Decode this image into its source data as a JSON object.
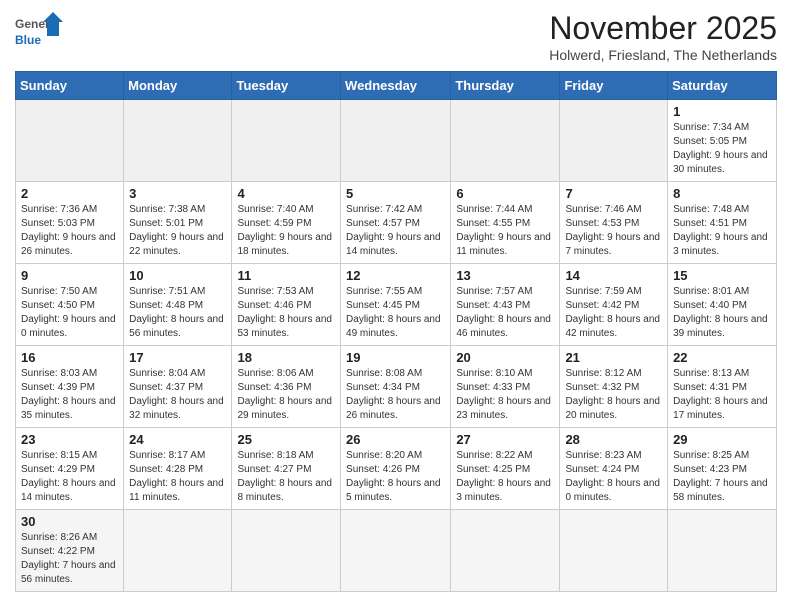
{
  "logo": {
    "general": "General",
    "blue": "Blue"
  },
  "title": "November 2025",
  "subtitle": "Holwerd, Friesland, The Netherlands",
  "headers": [
    "Sunday",
    "Monday",
    "Tuesday",
    "Wednesday",
    "Thursday",
    "Friday",
    "Saturday"
  ],
  "weeks": [
    [
      {
        "day": "",
        "info": "",
        "empty": true
      },
      {
        "day": "",
        "info": "",
        "empty": true
      },
      {
        "day": "",
        "info": "",
        "empty": true
      },
      {
        "day": "",
        "info": "",
        "empty": true
      },
      {
        "day": "",
        "info": "",
        "empty": true
      },
      {
        "day": "",
        "info": "",
        "empty": true
      },
      {
        "day": "1",
        "info": "Sunrise: 7:34 AM\nSunset: 5:05 PM\nDaylight: 9 hours and 30 minutes."
      }
    ],
    [
      {
        "day": "2",
        "info": "Sunrise: 7:36 AM\nSunset: 5:03 PM\nDaylight: 9 hours and 26 minutes."
      },
      {
        "day": "3",
        "info": "Sunrise: 7:38 AM\nSunset: 5:01 PM\nDaylight: 9 hours and 22 minutes."
      },
      {
        "day": "4",
        "info": "Sunrise: 7:40 AM\nSunset: 4:59 PM\nDaylight: 9 hours and 18 minutes."
      },
      {
        "day": "5",
        "info": "Sunrise: 7:42 AM\nSunset: 4:57 PM\nDaylight: 9 hours and 14 minutes."
      },
      {
        "day": "6",
        "info": "Sunrise: 7:44 AM\nSunset: 4:55 PM\nDaylight: 9 hours and 11 minutes."
      },
      {
        "day": "7",
        "info": "Sunrise: 7:46 AM\nSunset: 4:53 PM\nDaylight: 9 hours and 7 minutes."
      },
      {
        "day": "8",
        "info": "Sunrise: 7:48 AM\nSunset: 4:51 PM\nDaylight: 9 hours and 3 minutes."
      }
    ],
    [
      {
        "day": "9",
        "info": "Sunrise: 7:50 AM\nSunset: 4:50 PM\nDaylight: 9 hours and 0 minutes."
      },
      {
        "day": "10",
        "info": "Sunrise: 7:51 AM\nSunset: 4:48 PM\nDaylight: 8 hours and 56 minutes."
      },
      {
        "day": "11",
        "info": "Sunrise: 7:53 AM\nSunset: 4:46 PM\nDaylight: 8 hours and 53 minutes."
      },
      {
        "day": "12",
        "info": "Sunrise: 7:55 AM\nSunset: 4:45 PM\nDaylight: 8 hours and 49 minutes."
      },
      {
        "day": "13",
        "info": "Sunrise: 7:57 AM\nSunset: 4:43 PM\nDaylight: 8 hours and 46 minutes."
      },
      {
        "day": "14",
        "info": "Sunrise: 7:59 AM\nSunset: 4:42 PM\nDaylight: 8 hours and 42 minutes."
      },
      {
        "day": "15",
        "info": "Sunrise: 8:01 AM\nSunset: 4:40 PM\nDaylight: 8 hours and 39 minutes."
      }
    ],
    [
      {
        "day": "16",
        "info": "Sunrise: 8:03 AM\nSunset: 4:39 PM\nDaylight: 8 hours and 35 minutes."
      },
      {
        "day": "17",
        "info": "Sunrise: 8:04 AM\nSunset: 4:37 PM\nDaylight: 8 hours and 32 minutes."
      },
      {
        "day": "18",
        "info": "Sunrise: 8:06 AM\nSunset: 4:36 PM\nDaylight: 8 hours and 29 minutes."
      },
      {
        "day": "19",
        "info": "Sunrise: 8:08 AM\nSunset: 4:34 PM\nDaylight: 8 hours and 26 minutes."
      },
      {
        "day": "20",
        "info": "Sunrise: 8:10 AM\nSunset: 4:33 PM\nDaylight: 8 hours and 23 minutes."
      },
      {
        "day": "21",
        "info": "Sunrise: 8:12 AM\nSunset: 4:32 PM\nDaylight: 8 hours and 20 minutes."
      },
      {
        "day": "22",
        "info": "Sunrise: 8:13 AM\nSunset: 4:31 PM\nDaylight: 8 hours and 17 minutes."
      }
    ],
    [
      {
        "day": "23",
        "info": "Sunrise: 8:15 AM\nSunset: 4:29 PM\nDaylight: 8 hours and 14 minutes."
      },
      {
        "day": "24",
        "info": "Sunrise: 8:17 AM\nSunset: 4:28 PM\nDaylight: 8 hours and 11 minutes."
      },
      {
        "day": "25",
        "info": "Sunrise: 8:18 AM\nSunset: 4:27 PM\nDaylight: 8 hours and 8 minutes."
      },
      {
        "day": "26",
        "info": "Sunrise: 8:20 AM\nSunset: 4:26 PM\nDaylight: 8 hours and 5 minutes."
      },
      {
        "day": "27",
        "info": "Sunrise: 8:22 AM\nSunset: 4:25 PM\nDaylight: 8 hours and 3 minutes."
      },
      {
        "day": "28",
        "info": "Sunrise: 8:23 AM\nSunset: 4:24 PM\nDaylight: 8 hours and 0 minutes."
      },
      {
        "day": "29",
        "info": "Sunrise: 8:25 AM\nSunset: 4:23 PM\nDaylight: 7 hours and 58 minutes."
      }
    ],
    [
      {
        "day": "30",
        "info": "Sunrise: 8:26 AM\nSunset: 4:22 PM\nDaylight: 7 hours and 56 minutes.",
        "last": true
      },
      {
        "day": "",
        "info": "",
        "empty": true,
        "last": true
      },
      {
        "day": "",
        "info": "",
        "empty": true,
        "last": true
      },
      {
        "day": "",
        "info": "",
        "empty": true,
        "last": true
      },
      {
        "day": "",
        "info": "",
        "empty": true,
        "last": true
      },
      {
        "day": "",
        "info": "",
        "empty": true,
        "last": true
      },
      {
        "day": "",
        "info": "",
        "empty": true,
        "last": true
      }
    ]
  ]
}
